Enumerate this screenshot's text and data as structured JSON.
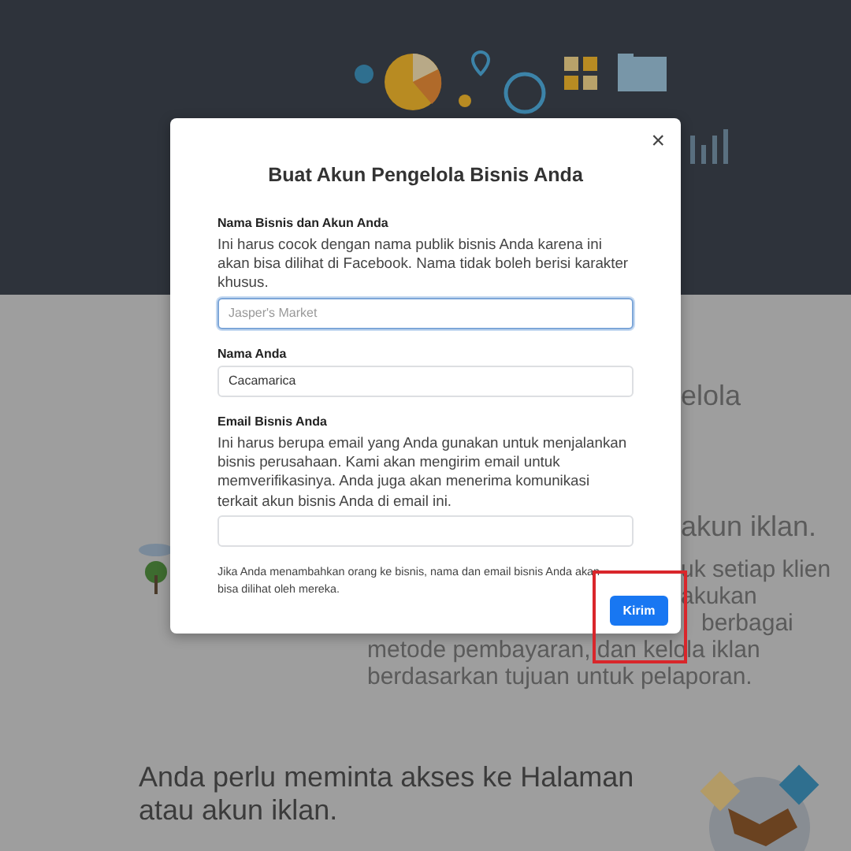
{
  "background": {
    "fragments": [
      {
        "kind": "heading",
        "text": "elola"
      },
      {
        "kind": "heading",
        "text": "akun iklan."
      },
      {
        "kind": "body",
        "text": "uk setiap klien"
      },
      {
        "kind": "body",
        "text": "akukan"
      },
      {
        "kind": "body",
        "text": "berbagai"
      }
    ],
    "lines": [
      "metode pembayaran, dan kelola iklan",
      "berdasarkan tujuan untuk pelaporan."
    ],
    "section_heading": "Anda perlu meminta akses ke Halaman atau akun iklan."
  },
  "modal": {
    "title": "Buat Akun Pengelola Bisnis Anda",
    "close": "×",
    "fields": [
      {
        "label": "Nama Bisnis dan Akun Anda",
        "help": "Ini harus cocok dengan nama publik bisnis Anda karena ini akan bisa dilihat di Facebook. Nama tidak boleh berisi karakter khusus.",
        "placeholder": "Jasper's Market",
        "focused": true
      },
      {
        "label": "Nama Anda",
        "value": "Cacamarica",
        "focused": false
      },
      {
        "label": "Email Bisnis Anda",
        "help": "Ini harus berupa email yang Anda gunakan untuk menjalankan bisnis perusahaan. Kami akan mengirim email untuk memverifikasinya. Anda juga akan menerima komunikasi terkait akun bisnis Anda di email ini.",
        "focused": false
      }
    ],
    "note": "Jika Anda menambahkan orang ke bisnis, nama dan email bisnis Anda akan bisa dilihat oleh mereka.",
    "submit": "Kirim",
    "submit_highlighted": true
  }
}
